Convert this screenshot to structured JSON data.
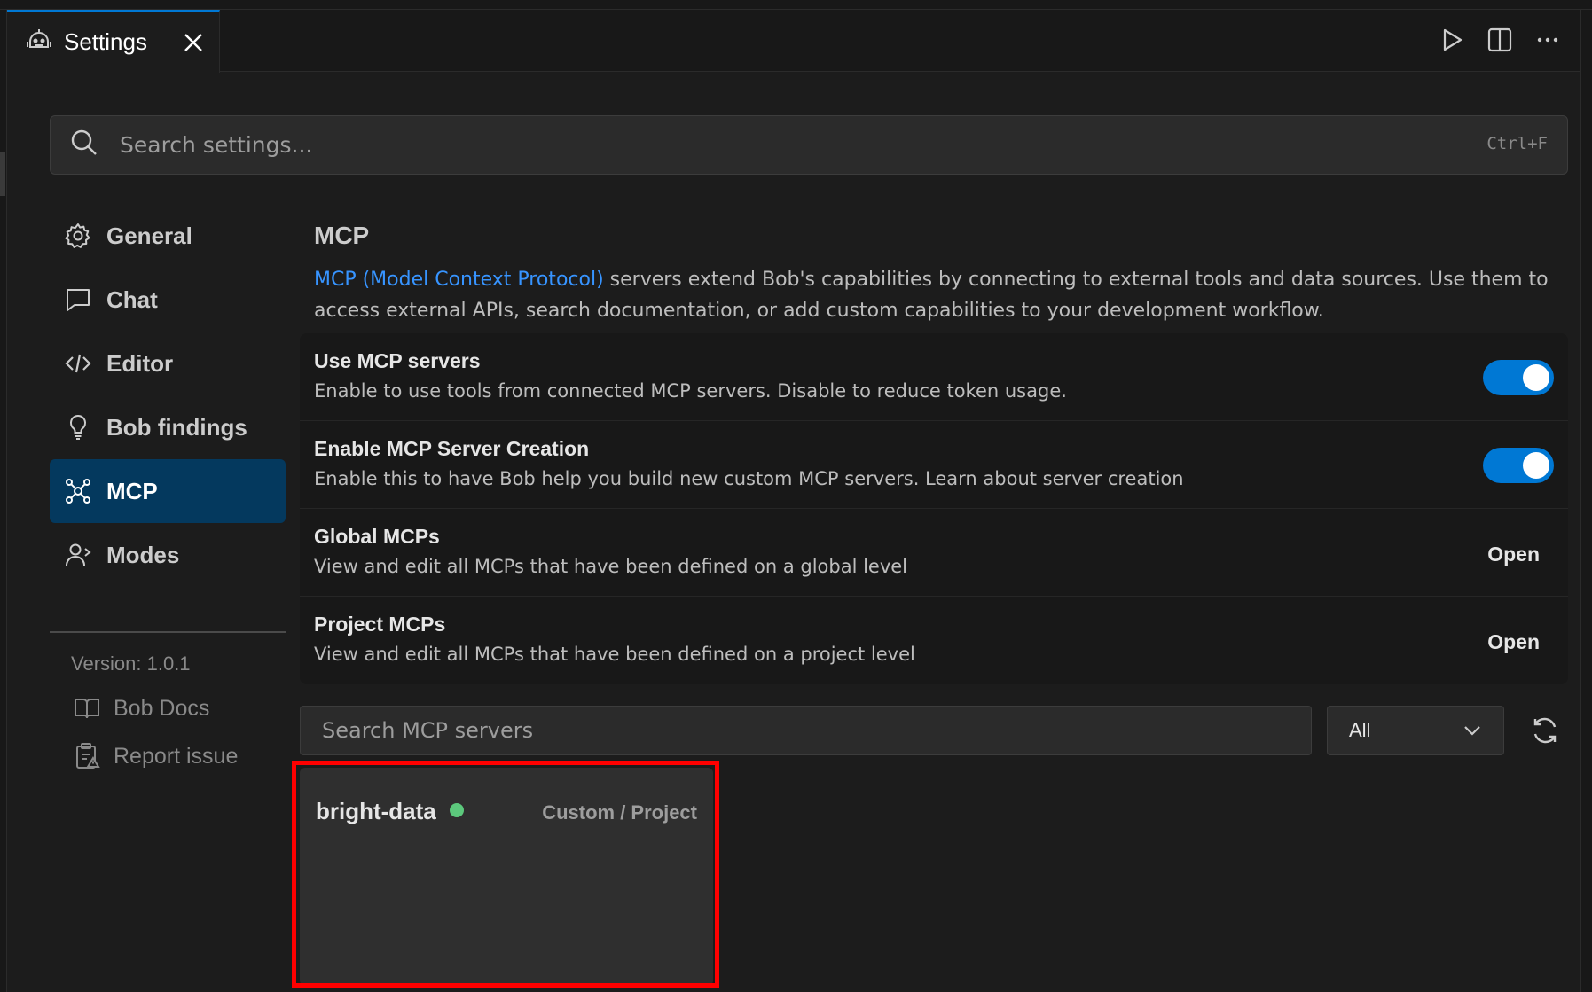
{
  "tab": {
    "title": "Settings"
  },
  "search": {
    "placeholder": "Search settings...",
    "shortcut": "Ctrl+F"
  },
  "sidebar": {
    "items": [
      {
        "label": "General",
        "icon": "gear-icon"
      },
      {
        "label": "Chat",
        "icon": "chat-bubble-icon"
      },
      {
        "label": "Editor",
        "icon": "code-icon"
      },
      {
        "label": "Bob findings",
        "icon": "lightbulb-icon"
      },
      {
        "label": "MCP",
        "icon": "mcp-network-icon",
        "active": true
      },
      {
        "label": "Modes",
        "icon": "person-modes-icon"
      }
    ],
    "version": "Version: 1.0.1",
    "links": [
      {
        "label": "Bob Docs",
        "icon": "book-icon"
      },
      {
        "label": "Report issue",
        "icon": "clipboard-alert-icon"
      }
    ]
  },
  "main": {
    "title": "MCP",
    "description": {
      "link_text": "MCP (Model Context Protocol)",
      "text": " servers extend Bob's capabilities by connecting to external tools and data sources. Use them to access external APIs, search documentation, or add custom capabilities to your development workflow."
    },
    "settings": [
      {
        "name": "Use MCP servers",
        "desc": "Enable to use tools from connected MCP servers. Disable to reduce token usage.",
        "control": "toggle",
        "on": true
      },
      {
        "name": "Enable MCP Server Creation",
        "desc": "Enable this to have Bob help you build new custom MCP servers. Learn about server creation",
        "control": "toggle",
        "on": true
      },
      {
        "name": "Global MCPs",
        "desc": "View and edit all MCPs that have been defined on a global level",
        "control": "button",
        "button_label": "Open"
      },
      {
        "name": "Project MCPs",
        "desc": "View and edit all MCPs that have been defined on a project level",
        "control": "button",
        "button_label": "Open"
      }
    ],
    "server_search": {
      "placeholder": "Search MCP servers"
    },
    "filter": {
      "selected": "All"
    },
    "servers": [
      {
        "name": "bright-data",
        "status": "connected",
        "status_color": "#5cc87c",
        "type": "Custom / Project"
      }
    ]
  },
  "colors": {
    "accent": "#0078d4",
    "active_nav": "#04395e",
    "link": "#3794ff",
    "highlight": "#ff0000"
  }
}
